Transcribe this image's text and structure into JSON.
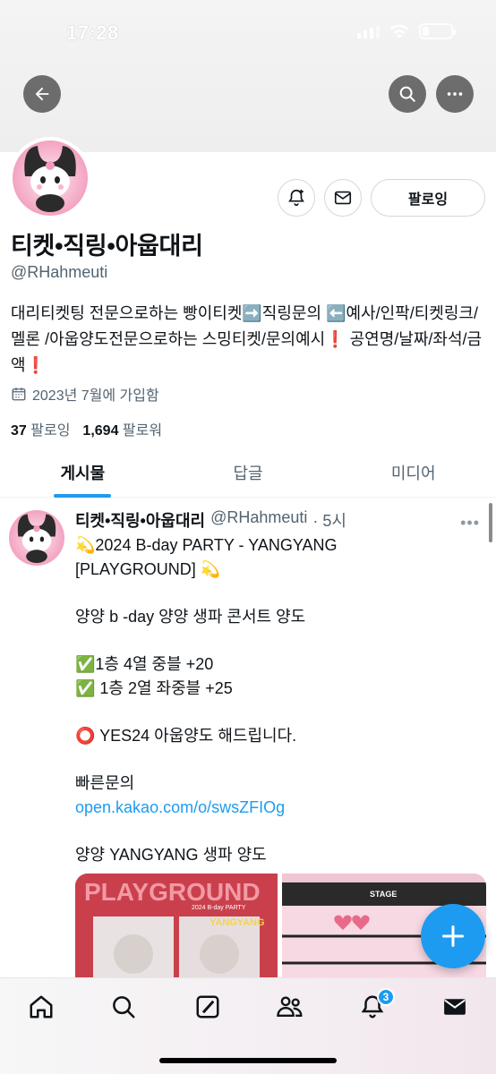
{
  "status_bar": {
    "time": "17:28"
  },
  "profile": {
    "display_name": "티켓•직링•아웁대리",
    "handle": "@RHahmeuti",
    "bio": "대리티켓팅 전문으로하는 빵이티켓➡️직링문의 ⬅️예사/인팍/티켓링크/멜론 /아웁양도전문으로하는 스밍티켓/문의예시❗ 공연명/날짜/좌석/금액❗",
    "joined": "2023년 7월에 가입함",
    "following_count": "37",
    "following_label": "팔로잉",
    "followers_count": "1,694",
    "followers_label": "팔로워",
    "follow_button": "팔로잉"
  },
  "tabs": [
    {
      "label": "게시물",
      "active": true
    },
    {
      "label": "답글",
      "active": false
    },
    {
      "label": "미디어",
      "active": false
    }
  ],
  "tweet": {
    "name": "티켓•직링•아웁대리",
    "handle": "@RHahmeuti",
    "time": "· 5시",
    "lines": {
      "l1": "💫2024 B-day PARTY - YANGYANG",
      "l2": "[PLAYGROUND] 💫",
      "l3": "양양 b -day 양양 생파 콘서트 양도",
      "l4": "✅1층  4열 중블  +20",
      "l5": "✅ 1층 2열 좌중블 +25",
      "l6": "⭕ YES24 아웁양도 해드립니다.",
      "l7": "빠른문의",
      "link": "open.kakao.com/o/swsZFIOg",
      "l8": "양양 YANGYANG 생파 양도"
    },
    "media": {
      "poster_text": "PLAYGROUND",
      "poster_sub": "2024 B-day PARTY",
      "poster_sub2": "YANGYANG",
      "stage_text": "STAGE"
    }
  },
  "nav": {
    "notifications_badge": "3"
  },
  "colors": {
    "accent": "#1d9bf0",
    "text": "#0f1419",
    "muted": "#536471"
  }
}
